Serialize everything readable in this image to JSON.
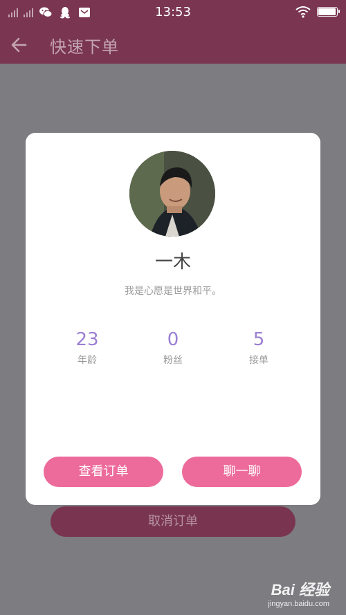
{
  "status_bar": {
    "time": "13:53",
    "battery_level": 0.95,
    "icons": [
      "signal-icon",
      "signal-icon",
      "wechat-icon",
      "qq-icon",
      "mail-icon",
      "wifi-icon",
      "battery-icon"
    ]
  },
  "app_bar": {
    "title": "快速下单",
    "back_icon": "arrow-left-icon"
  },
  "profile_dialog": {
    "name": "一木",
    "bio": "我是心愿是世界和平。",
    "stats": [
      {
        "value": "23",
        "label": "年龄"
      },
      {
        "value": "0",
        "label": "粉丝"
      },
      {
        "value": "5",
        "label": "接单"
      }
    ],
    "buttons": {
      "view_orders": "查看订单",
      "chat": "聊一聊"
    }
  },
  "background_button": {
    "cancel_order": "取消订单"
  },
  "watermark": {
    "logo": "Bai 经验",
    "sub": "jingyan.baidu.com"
  },
  "colors": {
    "primary": "#7a3651",
    "accent_pink": "#ec6b9a",
    "stat_purple": "#9b7fd4",
    "overlay": "#7d7c80"
  }
}
